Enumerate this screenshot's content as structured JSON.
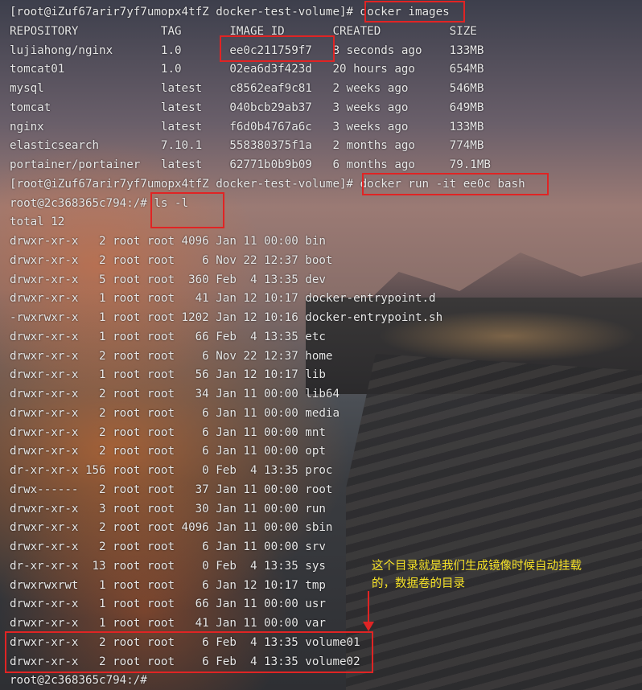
{
  "terminal": {
    "lines": [
      "[root@iZuf67arir7yf7umopx4tfZ docker-test-volume]# docker images",
      "REPOSITORY            TAG       IMAGE ID       CREATED          SIZE",
      "lujiahong/nginx       1.0       ee0c211759f7   8 seconds ago    133MB",
      "tomcat01              1.0       02ea6d3f423d   20 hours ago     654MB",
      "mysql                 latest    c8562eaf9c81   2 weeks ago      546MB",
      "tomcat                latest    040bcb29ab37   3 weeks ago      649MB",
      "nginx                 latest    f6d0b4767a6c   3 weeks ago      133MB",
      "elasticsearch         7.10.1    558380375f1a   2 months ago     774MB",
      "portainer/portainer   latest    62771b0b9b09   6 months ago     79.1MB",
      "[root@iZuf67arir7yf7umopx4tfZ docker-test-volume]# docker run -it ee0c bash",
      "root@2c368365c794:/# ls -l",
      "total 12",
      "drwxr-xr-x   2 root root 4096 Jan 11 00:00 bin",
      "drwxr-xr-x   2 root root    6 Nov 22 12:37 boot",
      "drwxr-xr-x   5 root root  360 Feb  4 13:35 dev",
      "drwxr-xr-x   1 root root   41 Jan 12 10:17 docker-entrypoint.d",
      "-rwxrwxr-x   1 root root 1202 Jan 12 10:16 docker-entrypoint.sh",
      "drwxr-xr-x   1 root root   66 Feb  4 13:35 etc",
      "drwxr-xr-x   2 root root    6 Nov 22 12:37 home",
      "drwxr-xr-x   1 root root   56 Jan 12 10:17 lib",
      "drwxr-xr-x   2 root root   34 Jan 11 00:00 lib64",
      "drwxr-xr-x   2 root root    6 Jan 11 00:00 media",
      "drwxr-xr-x   2 root root    6 Jan 11 00:00 mnt",
      "drwxr-xr-x   2 root root    6 Jan 11 00:00 opt",
      "dr-xr-xr-x 156 root root    0 Feb  4 13:35 proc",
      "drwx------   2 root root   37 Jan 11 00:00 root",
      "drwxr-xr-x   3 root root   30 Jan 11 00:00 run",
      "drwxr-xr-x   2 root root 4096 Jan 11 00:00 sbin",
      "drwxr-xr-x   2 root root    6 Jan 11 00:00 srv",
      "dr-xr-xr-x  13 root root    0 Feb  4 13:35 sys",
      "drwxrwxrwt   1 root root    6 Jan 12 10:17 tmp",
      "drwxr-xr-x   1 root root   66 Jan 11 00:00 usr",
      "drwxr-xr-x   1 root root   41 Jan 11 00:00 var",
      "drwxr-xr-x   2 root root    6 Feb  4 13:35 volume01",
      "drwxr-xr-x   2 root root    6 Feb  4 13:35 volume02",
      "root@2c368365c794:/#"
    ]
  },
  "annotation": {
    "note": "这个目录就是我们生成镜像时候自动挂载\n的，数据卷的目录"
  },
  "colors": {
    "text": "#e8e8e8",
    "highlight": "#e02424",
    "note": "#f6e227"
  }
}
